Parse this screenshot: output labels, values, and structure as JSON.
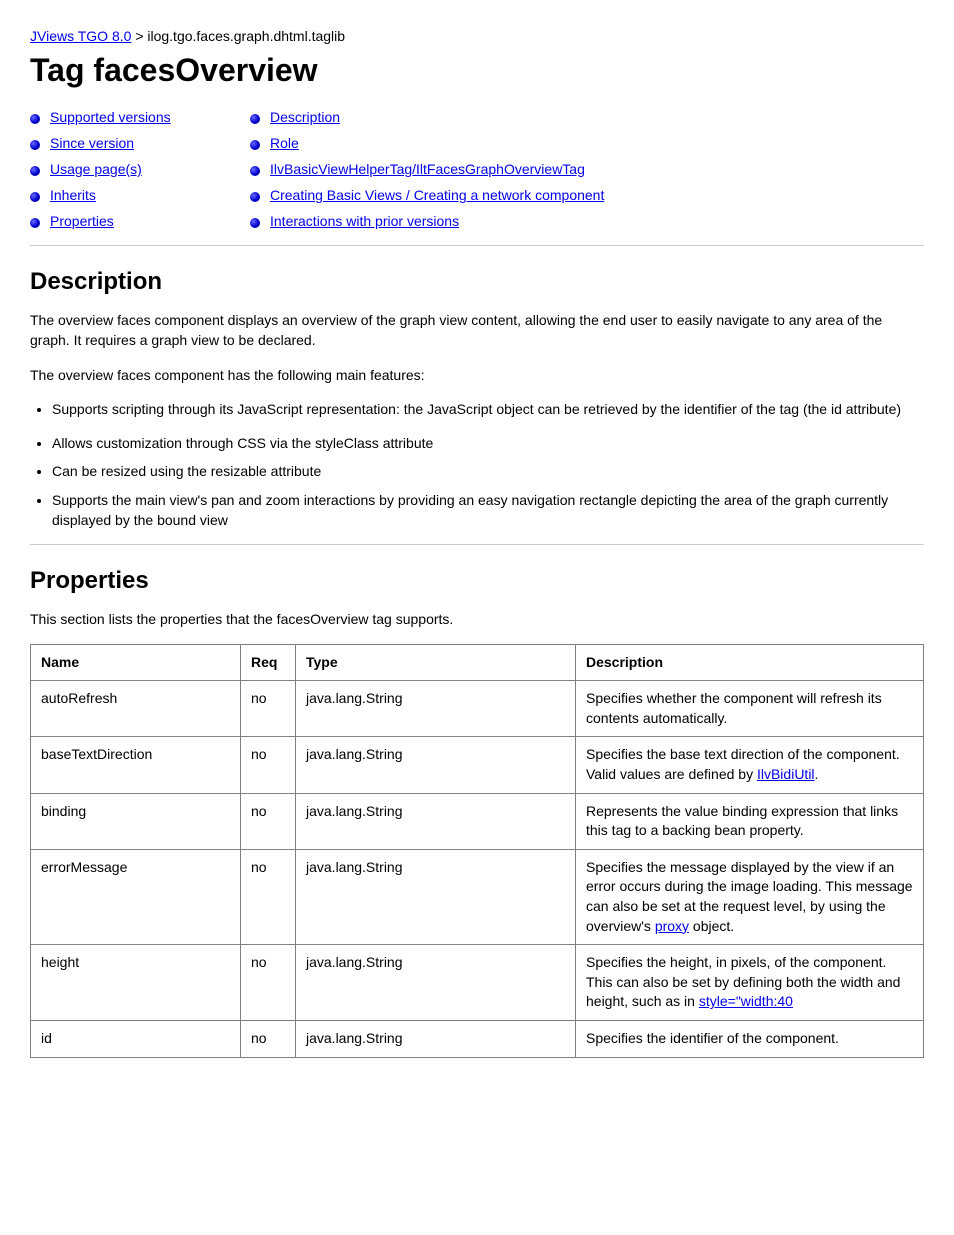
{
  "breadcrumb": {
    "link": "JViews TGO 8.0",
    "tail": "> ilog.tgo.faces.graph.dhtml.taglib"
  },
  "page_title": "Tag facesOverview",
  "toc": {
    "left": [
      "Supported versions",
      "Since version",
      "Usage page(s)",
      "Inherits",
      "Properties"
    ],
    "right": [
      "Description",
      "Role",
      "IlvBasicViewHelperTag/IltFacesGraphOverviewTag",
      "Creating Basic Views / Creating a network component",
      "Interactions with prior versions"
    ]
  },
  "description": {
    "heading": "Description",
    "text": "The overview faces component displays an overview of the graph view content, allowing the end user to easily navigate to any area of the graph. It requires a graph view to be declared.",
    "features_intro": "The overview faces component has the following main features:",
    "features": [
      "Supports scripting through its JavaScript representation: the JavaScript object can be retrieved by the identifier of the tag (the id attribute)",
      "Allows customization through CSS via the styleClass attribute",
      "Can be resized using the resizable attribute",
      "Supports the main view's pan and zoom interactions by providing an easy navigation rectangle depicting the area of the graph currently displayed by the bound view"
    ]
  },
  "props_section": {
    "heading": "Properties",
    "intro": "This section lists the properties that the facesOverview tag supports.",
    "columns": [
      "Name",
      "Req",
      "Type",
      "Description"
    ],
    "rows": [
      {
        "name": "autoRefresh",
        "req": "no",
        "type": "java.lang.String",
        "desc": "Specifies whether the component will refresh its contents automatically."
      },
      {
        "name": "baseTextDirection",
        "req": "no",
        "type": "java.lang.String",
        "desc_pre": "Specifies the base text direction of the component. Valid values are defined by ",
        "link": "IlvBidiUtil",
        "desc_post": "."
      },
      {
        "name": "binding",
        "req": "no",
        "type": "java.lang.String",
        "desc": "Represents the value binding expression that links this tag to a backing bean property."
      },
      {
        "name": "errorMessage",
        "req": "no",
        "type": "java.lang.String",
        "desc_pre": "Specifies the message displayed by the view if an error occurs during the image loading. This message can also be set at the request level, by using the overview's ",
        "link": "proxy",
        "desc_post": " object."
      },
      {
        "name": "height",
        "req": "no",
        "type": "java.lang.String",
        "desc_pre": "Specifies the height, in pixels, of the component. This can also be set by defining both the width and height, such as in ",
        "link": "style=\"width:40",
        "desc_post": ""
      },
      {
        "name": "id",
        "req": "no",
        "type": "java.lang.String",
        "desc": "Specifies the identifier of the component."
      }
    ]
  }
}
